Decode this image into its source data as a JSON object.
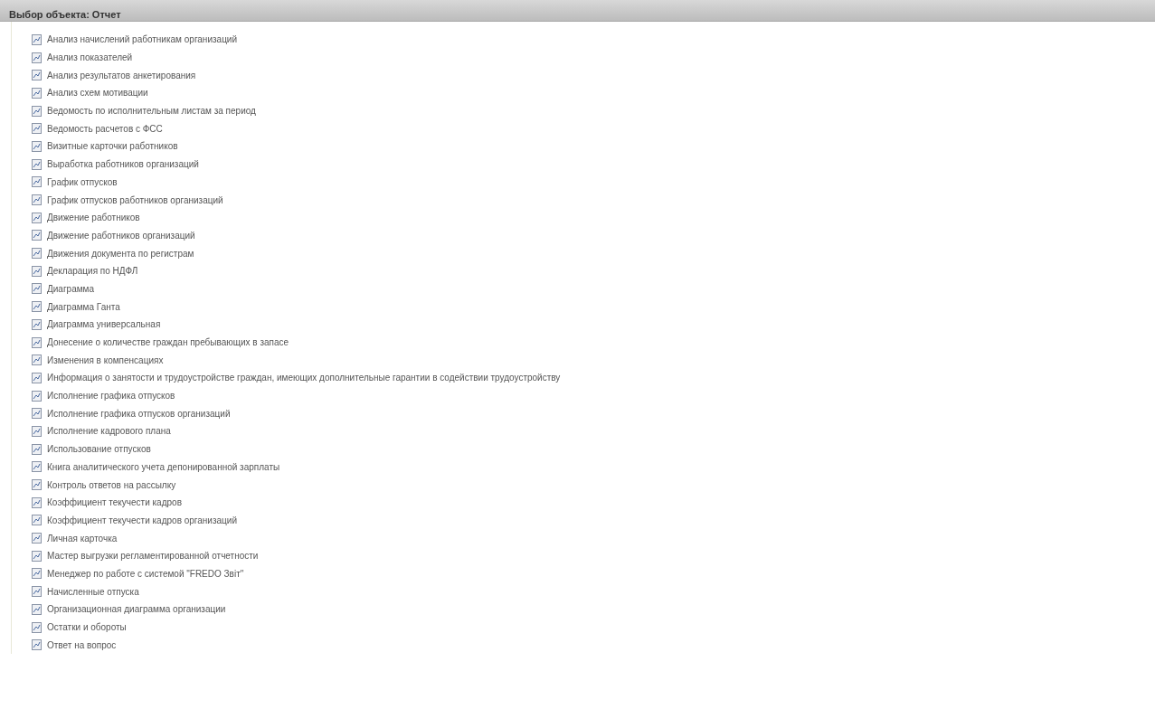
{
  "window": {
    "title": "Выбор объекта: Отчет"
  },
  "items": [
    {
      "label": "Анализ начислений работникам организаций"
    },
    {
      "label": "Анализ показателей"
    },
    {
      "label": "Анализ результатов анкетирования"
    },
    {
      "label": "Анализ схем мотивации"
    },
    {
      "label": "Ведомость по исполнительным листам за период"
    },
    {
      "label": "Ведомость расчетов с ФСС"
    },
    {
      "label": "Визитные карточки работников"
    },
    {
      "label": "Выработка работников организаций"
    },
    {
      "label": "График отпусков"
    },
    {
      "label": "График отпусков работников организаций"
    },
    {
      "label": "Движение работников"
    },
    {
      "label": "Движение работников организаций"
    },
    {
      "label": "Движения документа по регистрам"
    },
    {
      "label": "Декларация по НДФЛ"
    },
    {
      "label": "Диаграмма"
    },
    {
      "label": "Диаграмма Ганта"
    },
    {
      "label": "Диаграмма универсальная"
    },
    {
      "label": "Донесение о количестве граждан пребывающих в запасе"
    },
    {
      "label": "Изменения в компенсациях"
    },
    {
      "label": "Информация о занятости и трудоустройстве граждан, имеющих дополнительные гарантии в содействии трудоустройству"
    },
    {
      "label": "Исполнение графика отпусков"
    },
    {
      "label": "Исполнение графика отпусков организаций"
    },
    {
      "label": "Исполнение кадрового плана"
    },
    {
      "label": "Использование отпусков"
    },
    {
      "label": "Книга аналитического учета депонированной зарплаты"
    },
    {
      "label": "Контроль ответов на рассылку"
    },
    {
      "label": "Коэффициент текучести кадров"
    },
    {
      "label": "Коэффициент текучести кадров организаций"
    },
    {
      "label": "Личная карточка"
    },
    {
      "label": "Мастер выгрузки регламентированной отчетности"
    },
    {
      "label": "Менеджер по работе с системой \"FREDO Звіт\""
    },
    {
      "label": "Начисленные отпуска"
    },
    {
      "label": "Организационная диаграмма организации"
    },
    {
      "label": "Остатки и обороты"
    },
    {
      "label": "Ответ на вопрос"
    }
  ]
}
